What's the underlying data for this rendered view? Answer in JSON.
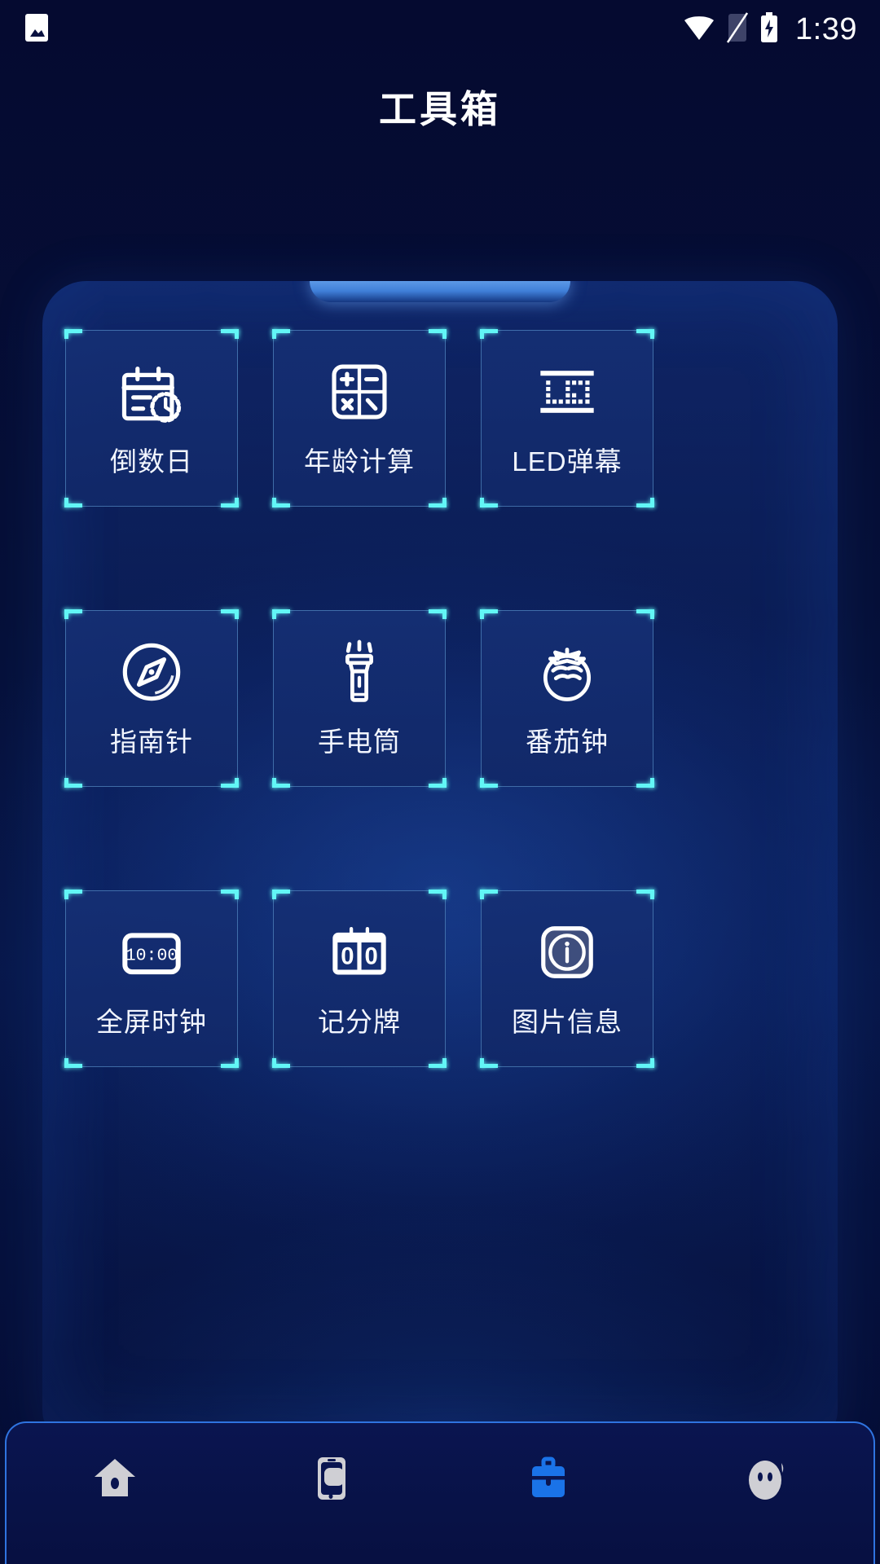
{
  "status_bar": {
    "left_icons": [
      {
        "name": "image-notification-icon"
      }
    ],
    "right_icons": [
      {
        "name": "wifi-icon"
      },
      {
        "name": "sim-card-icon"
      },
      {
        "name": "battery-charging-icon"
      }
    ],
    "time": "1:39"
  },
  "header": {
    "title": "工具箱"
  },
  "theme": {
    "background": "#050a30",
    "panel_blue": "#152f74",
    "corner_accent": "#62f6f6",
    "tile_border": "#5c96cd",
    "nav_border": "#2f74e0",
    "nav_active": "#1a73e8",
    "nav_inactive": "#cfcfd4",
    "text": "#ffffff"
  },
  "tools_grid": {
    "columns": 3,
    "items": [
      {
        "id": "countdown-day",
        "label": "倒数日",
        "icon": "calendar-clock-icon"
      },
      {
        "id": "age-calculator",
        "label": "年龄计算",
        "icon": "calculator-icon"
      },
      {
        "id": "led-banner",
        "label": "LED弹幕",
        "icon": "led-matrix-icon"
      },
      {
        "id": "compass",
        "label": "指南针",
        "icon": "compass-icon"
      },
      {
        "id": "flashlight",
        "label": "手电筒",
        "icon": "flashlight-icon"
      },
      {
        "id": "pomodoro",
        "label": "番茄钟",
        "icon": "tomato-icon"
      },
      {
        "id": "fullscreen-clock",
        "label": "全屏时钟",
        "icon": "digital-clock-icon",
        "icon_text": "10:00"
      },
      {
        "id": "scoreboard",
        "label": "记分牌",
        "icon": "scoreboard-icon",
        "icon_text_left": "0",
        "icon_text_right": "0"
      },
      {
        "id": "image-info",
        "label": "图片信息",
        "icon": "info-square-icon"
      }
    ]
  },
  "bottom_nav": {
    "items": [
      {
        "id": "home",
        "icon": "home-icon",
        "active": false
      },
      {
        "id": "device",
        "icon": "phone-icon",
        "active": false
      },
      {
        "id": "toolbox",
        "icon": "briefcase-icon",
        "active": true
      },
      {
        "id": "profile",
        "icon": "pig-avatar-icon",
        "active": false
      }
    ]
  }
}
